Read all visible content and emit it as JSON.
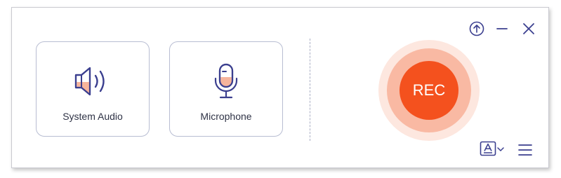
{
  "sources": {
    "system_audio": {
      "label": "System Audio",
      "icon": "speaker-icon"
    },
    "microphone": {
      "label": "Microphone",
      "icon": "microphone-icon"
    }
  },
  "record": {
    "label": "REC"
  },
  "window_controls": {
    "upgrade_icon": "upload-circle-icon",
    "minimize_icon": "minimize-icon",
    "close_icon": "close-icon"
  },
  "bottom_controls": {
    "watermark_icon": "text-format-icon",
    "dropdown_icon": "chevron-down-icon",
    "menu_icon": "hamburger-menu-icon"
  },
  "colors": {
    "accent": "#f4511e",
    "accent_ring": "#f9b9a3",
    "accent_halo": "#fde7df",
    "icon_stroke": "#3b3f8f",
    "icon_fill": "#f6b49c",
    "card_border": "#b8bdd2"
  }
}
